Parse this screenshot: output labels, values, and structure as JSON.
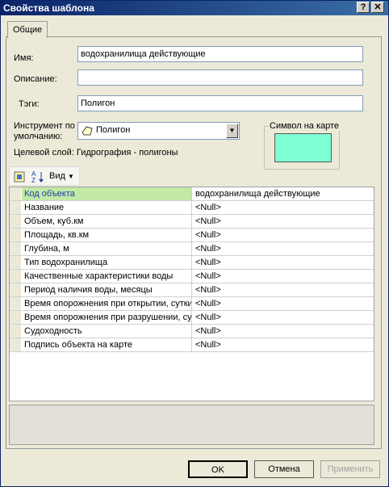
{
  "window": {
    "title": "Свойства шаблона"
  },
  "tabs": [
    {
      "label": "Общие"
    }
  ],
  "form": {
    "name_label": "Имя:",
    "name_value": "водохранилища действующие",
    "description_label": "Описание:",
    "description_value": "",
    "tags_label": "Тэги:",
    "tags_value": "Полигон",
    "tool_label_line1": "Инструмент по",
    "tool_label_line2": "умолчанию:",
    "tool_value": "Полигон",
    "target_layer": "Целевой слой: Гидрография - полигоны"
  },
  "symbol": {
    "title": "Символ на карте",
    "color": "#7fffd4"
  },
  "toolbar": {
    "view_label": "Вид"
  },
  "attributes": [
    {
      "name": "Код объекта",
      "value": "водохранилища действующие",
      "selected": true
    },
    {
      "name": "Название",
      "value": "<Null>"
    },
    {
      "name": "Объем, куб.км",
      "value": "<Null>"
    },
    {
      "name": "Площадь, кв.км",
      "value": "<Null>"
    },
    {
      "name": "Глубина, м",
      "value": "<Null>"
    },
    {
      "name": "Тип водохранилища",
      "value": "<Null>"
    },
    {
      "name": "Качественные характеристики воды",
      "value": "<Null>"
    },
    {
      "name": "Период наличия воды, месяцы",
      "value": "<Null>"
    },
    {
      "name": "Время опорожнения при открытии, сутки",
      "value": "<Null>"
    },
    {
      "name": "Время опорожнения при разрушении, сутки",
      "value": "<Null>"
    },
    {
      "name": "Судоходность",
      "value": "<Null>"
    },
    {
      "name": "Подпись объекта на карте",
      "value": "<Null>"
    }
  ],
  "buttons": {
    "ok": "OK",
    "cancel": "Отмена",
    "apply": "Применить"
  }
}
